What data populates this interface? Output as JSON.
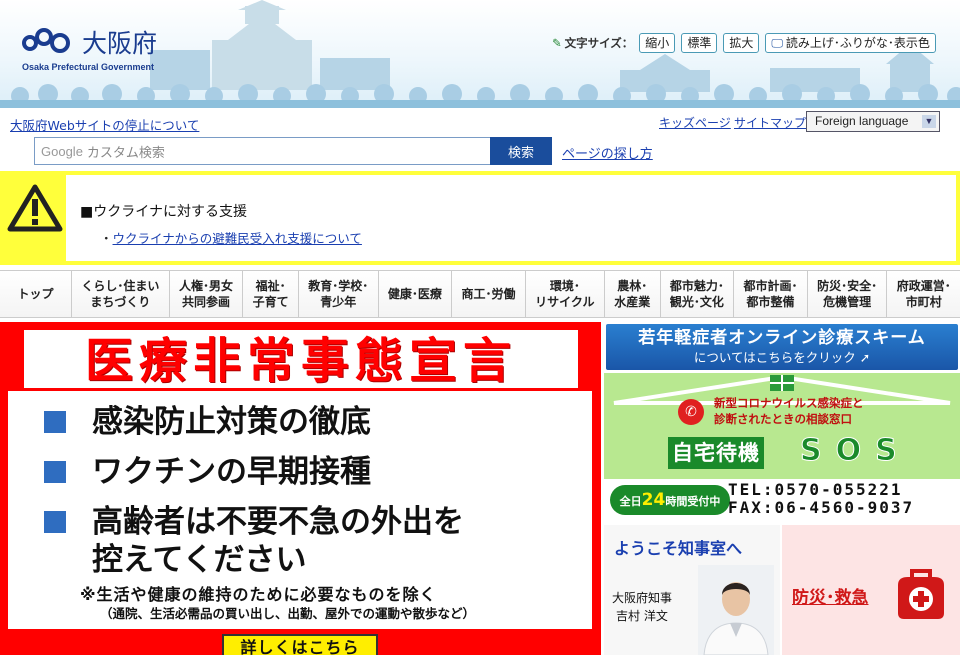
{
  "header": {
    "logo_text": "大阪府",
    "logo_sub": "Osaka Prefectural Government",
    "font_size_label": "文字サイズ：",
    "font_small": "縮小",
    "font_standard": "標準",
    "font_large": "拡大",
    "read_aloud": "読み上げ･ふりがな･表示色"
  },
  "util": {
    "stop_notice": "大阪府Webサイトの停止について",
    "kids": "キッズページ",
    "sitemap": "サイトマップ",
    "language": "Foreign language"
  },
  "search": {
    "google": "Google",
    "placeholder": "カスタム検索",
    "button": "検索",
    "page_find": "ページの探し方"
  },
  "alert": {
    "title": "■ウクライナに対する支援",
    "bullet": "・",
    "link": "ウクライナからの避難民受入れ支援について"
  },
  "nav": [
    "トップ",
    "くらし･住まい\nまちづくり",
    "人権･男女\n共同参画",
    "福祉･\n子育て",
    "教育･学校･\n青少年",
    "健康･医療",
    "商工･労働",
    "環境･\nリサイクル",
    "農林･\n水産業",
    "都市魅力･\n観光･文化",
    "都市計画･\n都市整備",
    "防災･安全･\n危機管理",
    "府政運営･\n市町村"
  ],
  "emergency": {
    "title": "医療非常事態宣言",
    "item1": "感染防止対策の徹底",
    "item2": "ワクチンの早期接種",
    "item3a": "高齢者は不要不急の外出を",
    "item3b": "控えてください",
    "note1": "※生活や健康の維持のために必要なものを除く",
    "note2": "（通院、生活必需品の買い出し、出勤、屋外での運動や散歩など）",
    "detail": "詳しくはこちら"
  },
  "youth": {
    "line1": "若年軽症者オンライン診療スキーム",
    "line2": "についてはこちらをクリック"
  },
  "sos": {
    "line1": "新型コロナウイルス感染症と",
    "line2": "診断されたときの相談窓口",
    "home": "自宅待機",
    "word": "SOS",
    "badge_pre": "全日",
    "badge_hours": "24",
    "badge_post": "時間受付中",
    "tel": "TEL:0570-055221",
    "fax": "FAX:06-4560-9037"
  },
  "governor": {
    "title": "ようこそ知事室へ",
    "role": "大阪府知事",
    "name": "吉村 洋文"
  },
  "disaster": {
    "label": "防災･救急"
  },
  "colors": {
    "brand_blue": "#1a3c8f",
    "alert_yellow": "#ffff3b",
    "emergency_red": "#ff0000",
    "sos_green": "#1a8a2a"
  }
}
